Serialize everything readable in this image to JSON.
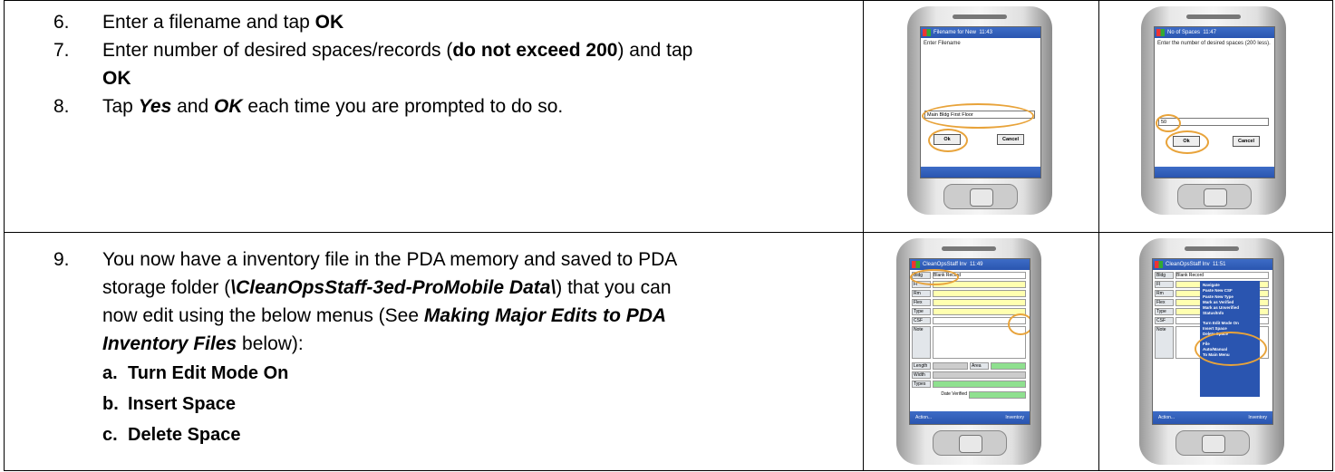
{
  "row1": {
    "steps": [
      {
        "num": "6.",
        "t1": "Enter a filename and tap ",
        "b1": "OK"
      },
      {
        "num": "7.",
        "t1": "Enter number of desired spaces/records (",
        "b1": "do not exceed 200",
        "t2": ") and tap",
        "b2": "OK"
      },
      {
        "num": "8.",
        "t1": "Tap ",
        "bi1": "Yes",
        "t2": " and ",
        "bi2": "OK",
        "t3": " each time you are prompted to do so."
      }
    ]
  },
  "row2": {
    "step": {
      "num": "9.",
      "line1": "You now have a inventory file in the PDA memory and saved to PDA",
      "line2a": "storage folder (",
      "line2b": "\\CleanOpsStaff-3ed-ProMobile Data\\",
      "line2c": ") that you can",
      "line3a": "now edit using the below menus (See ",
      "line3b": "Making Major Edits to PDA",
      "line4a": "Inventory Files",
      "line4b": " below):"
    },
    "subitems": [
      {
        "num": "a.",
        "label": "Turn Edit Mode On"
      },
      {
        "num": "b.",
        "label": "Insert Space"
      },
      {
        "num": "c.",
        "label": "Delete Space"
      }
    ]
  },
  "phones": {
    "filename": {
      "title": "Filename for New",
      "time": "11:43",
      "prompt": "Enter Filename",
      "value": "Main Bldg First Floor",
      "ok": "Ok",
      "cancel": "Cancel"
    },
    "spaces": {
      "title": "No of Spaces",
      "time": "11:47",
      "prompt": "Enter the number of desired spaces (200 less).",
      "value": "50",
      "ok": "Ok",
      "cancel": "Cancel"
    },
    "record": {
      "title": "CleanOpsStaff Inv",
      "time": "11:49",
      "bldg": "Bldg",
      "bldg_value": "Blank Record",
      "labels": [
        "Fl",
        "Rm",
        "Flex",
        "Type",
        "CSF",
        "Note",
        "Length",
        "Width",
        "Types"
      ],
      "area": "Area",
      "date": "Date Verified",
      "action": "Action...",
      "inventory": "Inventory"
    },
    "menu": {
      "title": "CleanOpsStaff Inv",
      "time": "11:51",
      "items": [
        "Navigate",
        "Paste New CSF",
        "Paste New Type",
        "Mark as Verified",
        "Mark as Unverified",
        "Status/Info",
        "Turn Edit Mode On",
        "Insert Space",
        "Delete Space",
        "File",
        "Auto/Manual",
        "To Main Menu"
      ]
    }
  }
}
